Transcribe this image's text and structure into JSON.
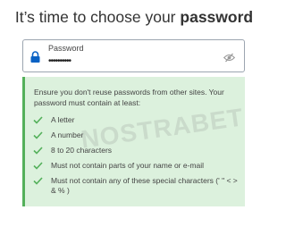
{
  "heading": {
    "prefix": "It’s time to choose your ",
    "emphasis": "password"
  },
  "password_field": {
    "label": "Password",
    "value": "••••••••••",
    "lock_icon": "lock-icon",
    "toggle_icon": "eye-off-icon"
  },
  "requirements": {
    "intro": "Ensure you don't reuse passwords from other sites. Your password must contain at least:",
    "items": [
      "A letter",
      "A number",
      "8 to 20 characters",
      "Must not contain parts of your name or e-mail",
      "Must not contain any of these special characters (' \" < > & % )"
    ],
    "check_icon": "check-icon"
  },
  "watermark": "NOSTRABET",
  "colors": {
    "accent_blue": "#0a62c4",
    "success_green": "#53b05a",
    "box_background": "#dcf1dd"
  }
}
